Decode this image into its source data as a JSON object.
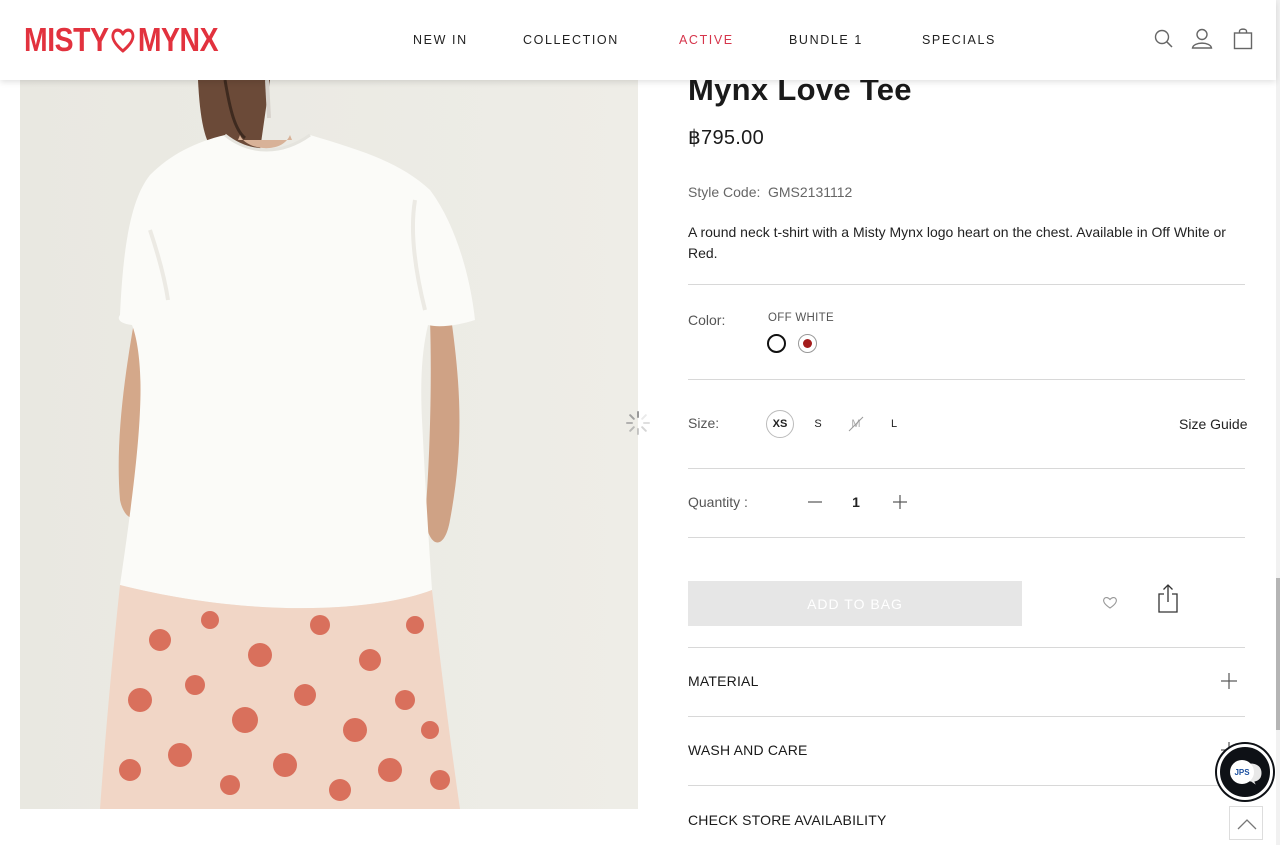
{
  "brand": {
    "left": "MISTY",
    "right": "MYNX",
    "color": "#e2323e"
  },
  "nav": {
    "items": [
      {
        "label": "NEW IN",
        "active": false
      },
      {
        "label": "COLLECTION",
        "active": false
      },
      {
        "label": "ACTIVE",
        "active": true
      },
      {
        "label": "BUNDLE 1",
        "active": false
      },
      {
        "label": "SPECIALS",
        "active": false
      }
    ],
    "icons": [
      "search-icon",
      "user-icon",
      "bag-icon"
    ],
    "active_color": "#d6354b"
  },
  "product": {
    "title": "Mynx Love Tee",
    "price": "฿795.00",
    "style_label": "Style Code:",
    "style_code": "GMS2131112",
    "description": "A round neck t-shirt with a Misty Mynx logo heart on the chest. Available in Off White or Red.",
    "color": {
      "label": "Color:",
      "selected_name": "OFF WHITE",
      "options": [
        {
          "name": "off-white",
          "hex": "#ffffff",
          "selected": true
        },
        {
          "name": "red",
          "hex": "#a41c1c",
          "selected": false
        }
      ]
    },
    "size": {
      "label": "Size:",
      "options": [
        {
          "label": "XS",
          "selected": true,
          "available": true
        },
        {
          "label": "S",
          "selected": false,
          "available": true
        },
        {
          "label": "M",
          "selected": false,
          "available": false
        },
        {
          "label": "L",
          "selected": false,
          "available": true
        }
      ],
      "guide_label": "Size Guide"
    },
    "quantity": {
      "label": "Quantity :",
      "value": "1",
      "minus": "—",
      "plus": "+"
    },
    "add_to_bag": "ADD TO BAG",
    "accordions": [
      {
        "label": "MATERIAL"
      },
      {
        "label": "WASH AND CARE"
      },
      {
        "label": "CHECK STORE AVAILABILITY"
      }
    ]
  },
  "chat_widget": {
    "label": "JPS"
  }
}
